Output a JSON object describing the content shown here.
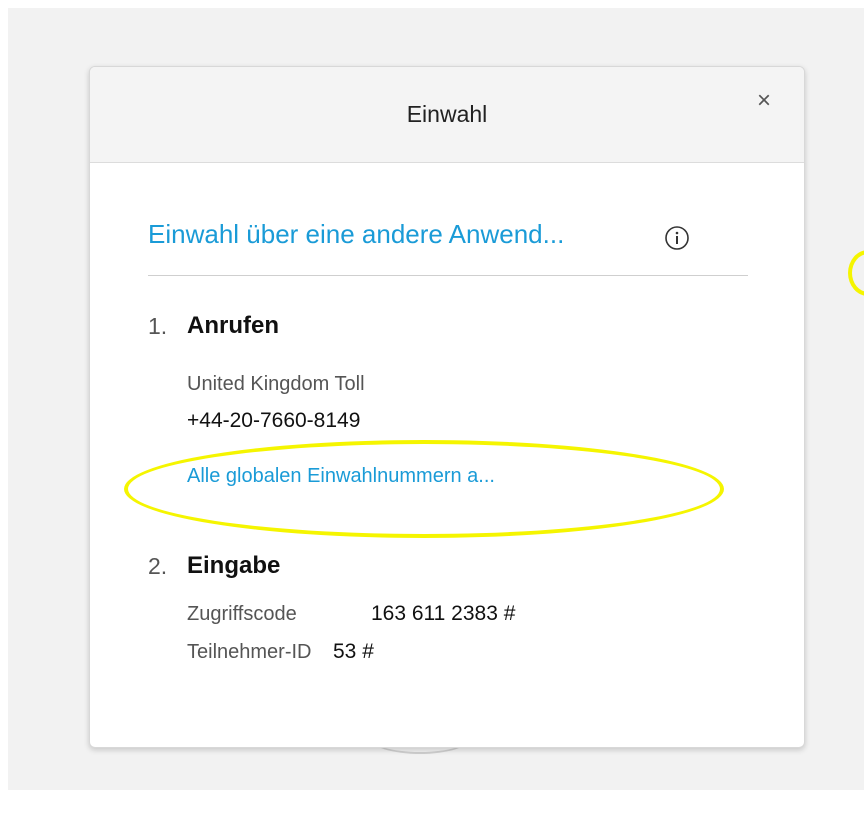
{
  "dialog": {
    "title": "Einwahl",
    "close_label": "×",
    "alt_app_link": "Einwahl über eine andere Anwend...",
    "step1": {
      "number": "1.",
      "title": "Anrufen",
      "location": "United Kingdom Toll",
      "phone": "+44-20-7660-8149",
      "global_numbers_link": "Alle globalen Einwahlnummern a..."
    },
    "step2": {
      "number": "2.",
      "title": "Eingabe",
      "access_code_label": "Zugriffscode",
      "access_code_value": "163 611 2383 #",
      "participant_id_label": "Teilnehmer-ID",
      "participant_id_value": "53 #"
    }
  },
  "icons": {
    "close": "close-icon",
    "info": "info-icon"
  },
  "colors": {
    "link": "#1a9bd7",
    "highlight": "#f5f500",
    "header_bg": "#f4f4f4",
    "backdrop": "#f2f2f2"
  }
}
